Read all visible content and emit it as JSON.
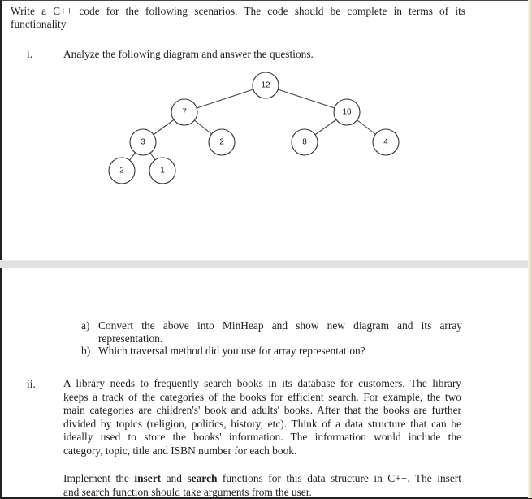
{
  "document": {
    "intro_line1": "Write a C++ code for the following scenarios. The code should be complete in terms of its",
    "intro_line2": "functionality",
    "question1": {
      "number": "i.",
      "text": "Analyze the following diagram and answer the questions.",
      "diagram": {
        "type": "binary-tree",
        "nodes": [
          {
            "id": "n0",
            "value": "12",
            "parent": null
          },
          {
            "id": "n1",
            "value": "7",
            "parent": "n0"
          },
          {
            "id": "n2",
            "value": "10",
            "parent": "n0"
          },
          {
            "id": "n3",
            "value": "3",
            "parent": "n1"
          },
          {
            "id": "n4",
            "value": "2",
            "parent": "n1"
          },
          {
            "id": "n5",
            "value": "8",
            "parent": "n2"
          },
          {
            "id": "n6",
            "value": "4",
            "parent": "n2"
          },
          {
            "id": "n7",
            "value": "2",
            "parent": "n3"
          },
          {
            "id": "n8",
            "value": "1",
            "parent": "n3"
          }
        ]
      },
      "subquestions": [
        {
          "label": "a)",
          "line1": "Convert the above into MinHeap and show new diagram and its array",
          "line2": "representation."
        },
        {
          "label": "b)",
          "line1": "Which traversal method did you use for array representation?"
        }
      ]
    },
    "question2": {
      "number": "ii.",
      "paragraph1_lines": [
        "A library needs to frequently search books in its database for customers. The library",
        "keeps a track of the categories of the books for efficient search. For example, the two",
        "main categories are children's' book and adults' books. After that the books are further",
        "divided by topics (religion, politics, history, etc). Think of a data structure that can be",
        "ideally used to store the books' information. The information would include the",
        "category, topic, title and ISBN number for each book."
      ],
      "paragraph2": {
        "part1": "Implement the ",
        "bold1": "insert",
        "part2": " and ",
        "bold2": "search",
        "part3": " functions for this data structure in C++. The insert",
        "line2": "and search function should take arguments from the user."
      }
    }
  }
}
